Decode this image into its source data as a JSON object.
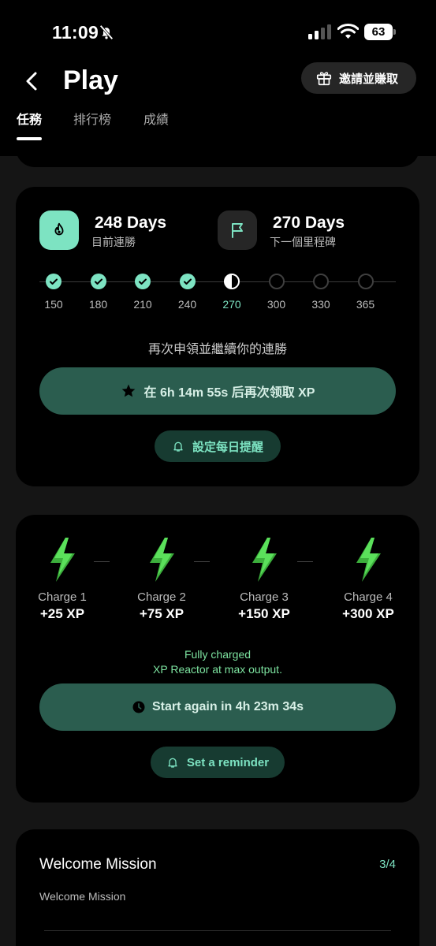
{
  "status_bar": {
    "time": "11:09",
    "battery": "63",
    "icons": [
      "bell-slash-icon",
      "signal-icon",
      "wifi-icon",
      "battery-icon"
    ]
  },
  "header": {
    "title": "Play",
    "back_icon": "chevron-left-icon",
    "invite_label": "邀請並賺取",
    "invite_icon": "gift-icon",
    "tabs": [
      {
        "label": "任務",
        "active": true
      },
      {
        "label": "排行榜",
        "active": false
      },
      {
        "label": "成績",
        "active": false
      }
    ]
  },
  "streak": {
    "current_value": "248 Days",
    "current_label": "目前連勝",
    "current_icon": "flame-icon",
    "next_value": "270 Days",
    "next_label": "下一個里程碑",
    "next_icon": "flag-icon",
    "milestones": [
      {
        "label": "150",
        "state": "done"
      },
      {
        "label": "180",
        "state": "done"
      },
      {
        "label": "210",
        "state": "done"
      },
      {
        "label": "240",
        "state": "done"
      },
      {
        "label": "270",
        "state": "current"
      },
      {
        "label": "300",
        "state": "todo"
      },
      {
        "label": "330",
        "state": "todo"
      },
      {
        "label": "365",
        "state": "todo"
      }
    ],
    "prompt": "再次申領並繼續你的連勝",
    "claim_label": "在 6h 14m 55s 后再次领取 XP",
    "claim_icon": "star-icon",
    "reminder_label": "設定每日提醒",
    "reminder_icon": "bell-icon"
  },
  "reactor": {
    "charges": [
      {
        "name": "Charge 1",
        "xp": "+25 XP"
      },
      {
        "name": "Charge 2",
        "xp": "+75 XP"
      },
      {
        "name": "Charge 3",
        "xp": "+150 XP"
      },
      {
        "name": "Charge 4",
        "xp": "+300 XP"
      }
    ],
    "status_line1": "Fully charged",
    "status_line2": "XP Reactor at max output.",
    "restart_label": "Start again in 4h 23m 34s",
    "restart_icon": "clock-icon",
    "reminder_label": "Set a reminder",
    "reminder_icon": "bell-icon"
  },
  "mission": {
    "title": "Welcome Mission",
    "progress": "3/4",
    "subtitle": "Welcome Mission"
  },
  "colors": {
    "accent": "#7de3c2",
    "button_bg": "#2b5d4f",
    "pill_bg": "#173b31",
    "card_bg": "#000000",
    "page_bg": "#151515"
  }
}
